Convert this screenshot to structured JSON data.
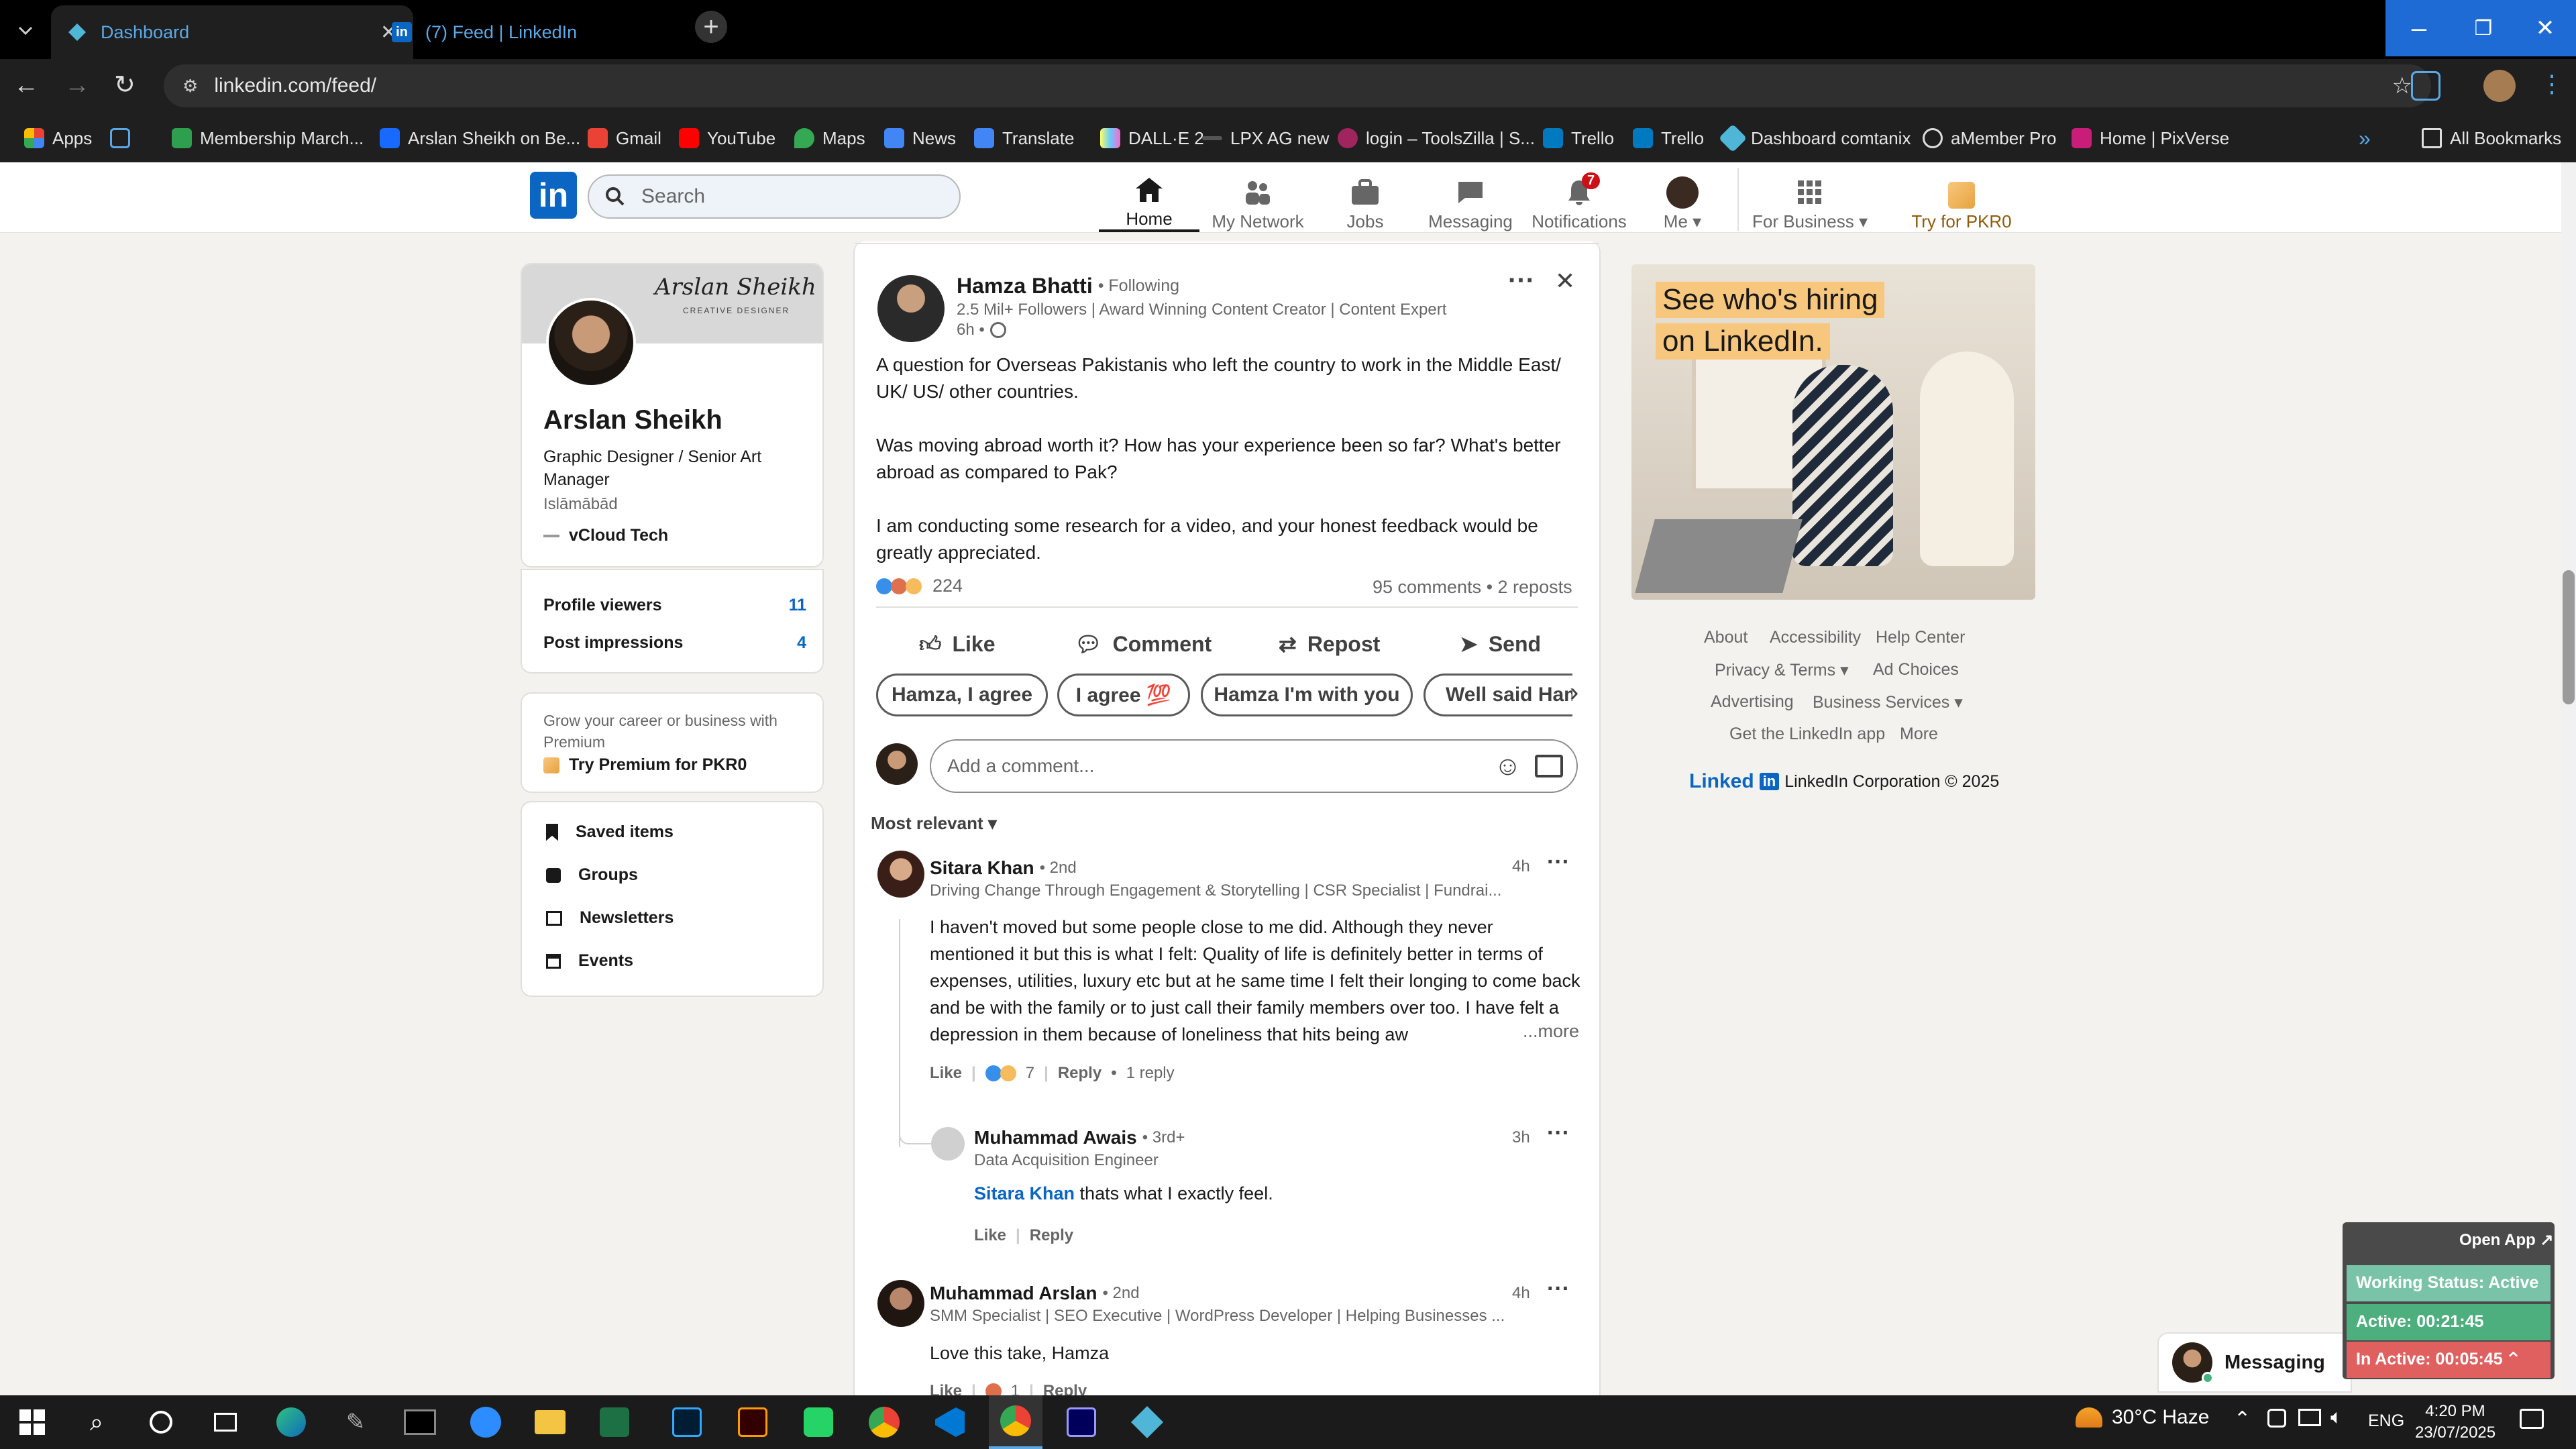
{
  "browser": {
    "tabs": [
      {
        "title": "Dashboard"
      },
      {
        "title": "(7) Feed | LinkedIn"
      }
    ],
    "url": "linkedin.com/feed/",
    "bookmarks": [
      "Apps",
      "Membership March...",
      "Arslan Sheikh on Be...",
      "Gmail",
      "YouTube",
      "Maps",
      "News",
      "Translate",
      "DALL·E 2",
      "LPX AG new",
      "login – ToolsZilla | S...",
      "Trello",
      "Trello",
      "Dashboard comtanix",
      "aMember Pro",
      "Home | PixVerse"
    ],
    "all_bookmarks": "All Bookmarks"
  },
  "nav": {
    "search_placeholder": "Search",
    "items": [
      {
        "label": "Home"
      },
      {
        "label": "My Network"
      },
      {
        "label": "Jobs"
      },
      {
        "label": "Messaging"
      },
      {
        "label": "Notifications",
        "badge": "7"
      },
      {
        "label": "Me"
      },
      {
        "label": "For Business"
      },
      {
        "label": "Try for PKR0"
      }
    ]
  },
  "profile": {
    "banner_script": "Arslan Sheikh",
    "banner_sub": "CREATIVE DESIGNER",
    "name": "Arslan Sheikh",
    "headline": "Graphic Designer / Senior Art Manager",
    "location": "Islāmābād",
    "company": "vCloud Tech",
    "stats": [
      {
        "label": "Profile viewers",
        "value": "11"
      },
      {
        "label": "Post impressions",
        "value": "4"
      }
    ],
    "premium_text": "Grow your career or business with Premium",
    "premium_cta": "Try Premium for PKR0",
    "links": [
      "Saved items",
      "Groups",
      "Newsletters",
      "Events"
    ]
  },
  "post": {
    "author": "Hamza Bhatti",
    "follow": "• Following",
    "meta": "2.5 Mil+ Followers | Award Winning Content Creator | Content Expert",
    "time": "6h •",
    "paragraphs": [
      "A question for Overseas Pakistanis who left the country to work in the Middle East/ UK/ US/ other countries.",
      "Was moving abroad worth it? How has your experience been so far? What's better abroad as compared to Pak?",
      "I am conducting some research for a video, and your honest feedback would be greatly appreciated."
    ],
    "reactions": "224",
    "stats": "95 comments • 2 reposts",
    "actions": [
      "Like",
      "Comment",
      "Repost",
      "Send"
    ],
    "suggestions": [
      "Hamza, I agree",
      "I agree 💯",
      "Hamza I'm with you",
      "Well said Ham"
    ],
    "comment_placeholder": "Add a comment...",
    "sort": "Most relevant"
  },
  "comments": [
    {
      "name": "Sitara Khan",
      "degree": "• 2nd",
      "headline": "Driving Change Through Engagement & Storytelling | CSR Specialist | Fundrai...",
      "time": "4h",
      "text": "I haven't moved but some people close to me did. Although they never mentioned it but this is what I felt: Quality of life is definitely better in terms of expenses, utilities, luxury etc but at he same time I felt their longing to come back and be with the family or to just call their family members over too. I have felt a depression in them because of loneliness that hits being aw",
      "more": "...more",
      "like": "Like",
      "count": "7",
      "reply": "Reply",
      "replies": "1 reply"
    },
    {
      "name": "Muhammad Awais",
      "degree": "• 3rd+",
      "headline": "Data Acquisition Engineer",
      "time": "3h",
      "mention": "Sitara Khan",
      "text": " thats what I exactly feel.",
      "like": "Like",
      "reply": "Reply"
    },
    {
      "name": "Muhammad Arslan",
      "degree": "• 2nd",
      "headline": "SMM Specialist | SEO Executive | WordPress Developer | Helping Businesses ...",
      "time": "4h",
      "text": "Love this take, Hamza",
      "like": "Like",
      "count": "1",
      "reply": "Reply"
    }
  ],
  "ad": {
    "line1": "See who's hiring",
    "line2": "on LinkedIn."
  },
  "footer": {
    "links": [
      "About",
      "Accessibility",
      "Help Center",
      "Privacy & Terms",
      "Ad Choices",
      "Advertising",
      "Business Services",
      "Get the LinkedIn app",
      "More"
    ],
    "brand": "Linked",
    "copyright": "LinkedIn Corporation © 2025"
  },
  "messaging": "Messaging",
  "widget": {
    "open": "Open App ↗",
    "status": "Working Status: Active",
    "active": "Active: 00:21:45",
    "inactive": "In Active: 00:05:45"
  },
  "taskbar": {
    "weather": "30°C Haze",
    "lang": "ENG",
    "time": "4:20 PM",
    "date": "23/07/2025"
  },
  "colors": {
    "linkedin_blue": "#0a66c2",
    "status_green": "#4caf7d",
    "inactive_red": "#e06060"
  }
}
